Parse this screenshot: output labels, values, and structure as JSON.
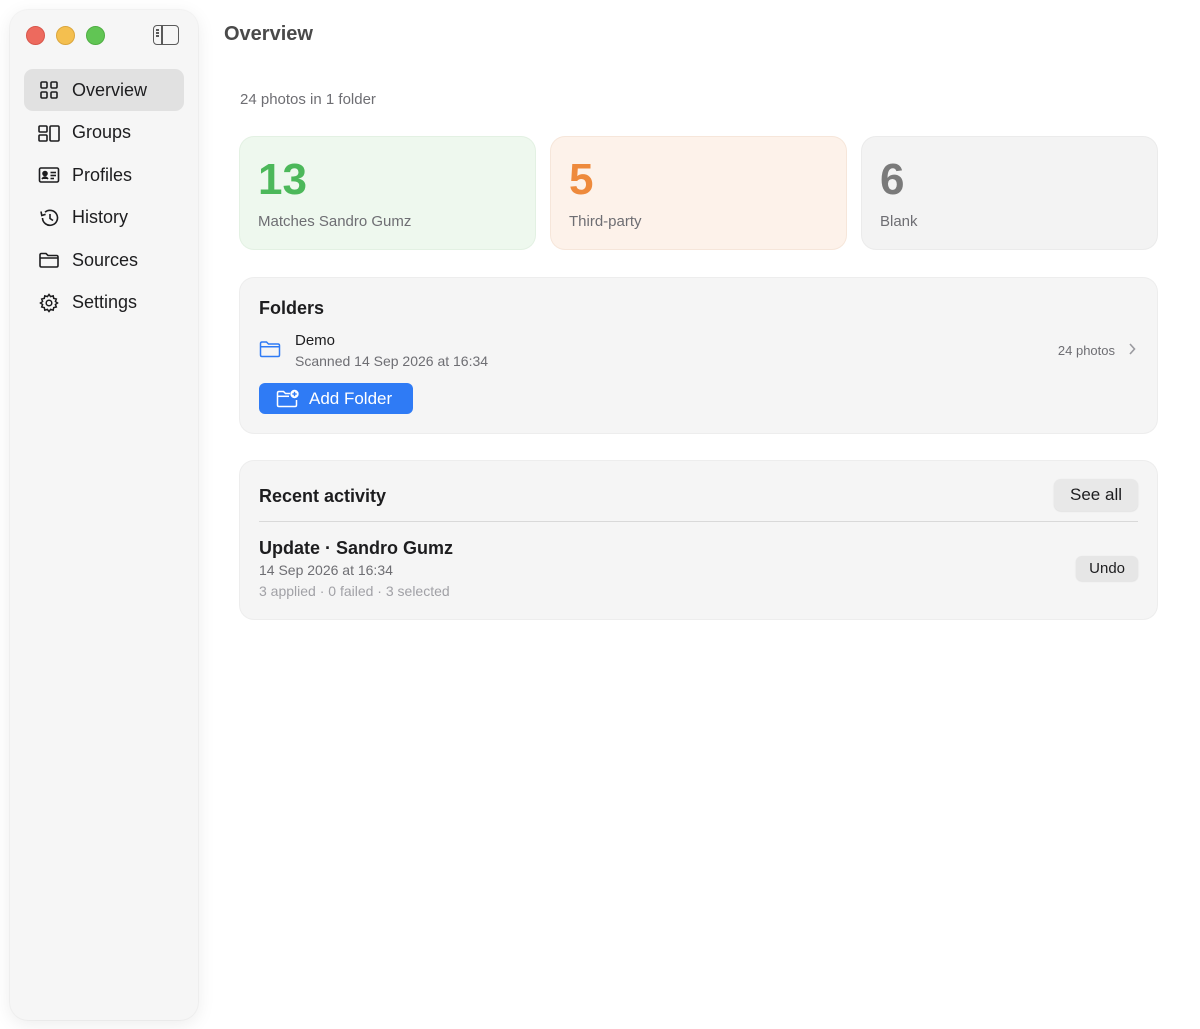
{
  "sidebar": {
    "items": [
      {
        "label": "Overview",
        "icon": "grid-icon",
        "active": true
      },
      {
        "label": "Groups",
        "icon": "groups-icon",
        "active": false
      },
      {
        "label": "Profiles",
        "icon": "id-card-icon",
        "active": false
      },
      {
        "label": "History",
        "icon": "clock-history-icon",
        "active": false
      },
      {
        "label": "Sources",
        "icon": "folder-icon",
        "active": false
      },
      {
        "label": "Settings",
        "icon": "gear-icon",
        "active": false
      }
    ]
  },
  "header": {
    "title": "Overview",
    "subtitle": "24 photos in 1 folder"
  },
  "stats": [
    {
      "value": "13",
      "label": "Matches Sandro Gumz",
      "color": "#4cb85a"
    },
    {
      "value": "5",
      "label": "Third-party",
      "color": "#ee8a3c"
    },
    {
      "value": "6",
      "label": "Blank",
      "color": "#7a7a7a"
    }
  ],
  "folders": {
    "title": "Folders",
    "items": [
      {
        "name": "Demo",
        "scanned": "Scanned 14 Sep 2026 at 16:34",
        "count": "24 photos"
      }
    ],
    "add_label": "Add Folder",
    "accent": "#2f7bf5"
  },
  "activity": {
    "title": "Recent activity",
    "see_all_label": "See all",
    "items": [
      {
        "title": "Update · Sandro Gumz",
        "date": "14 Sep 2026 at 16:34",
        "stats": "3 applied · 0 failed · 3 selected",
        "undo_label": "Undo"
      }
    ]
  }
}
